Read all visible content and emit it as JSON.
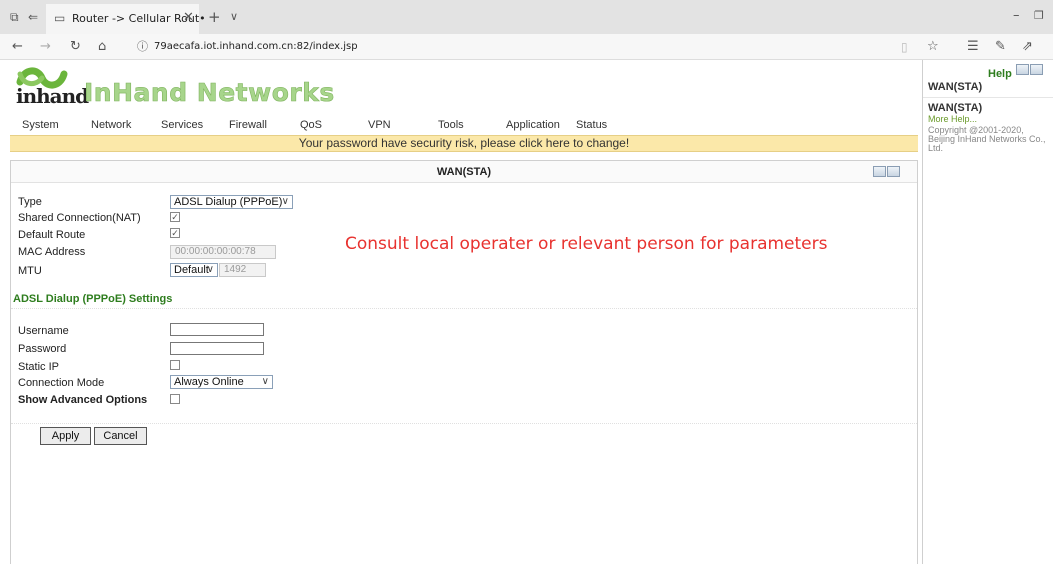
{
  "browser": {
    "tab_title": "Router -> Cellular Rout•",
    "url": "79aecafa.iot.inhand.com.cn:82/index.jsp"
  },
  "header": {
    "logo_word": "inhand",
    "brand": "InHand Networks"
  },
  "menu": [
    "System",
    "Network",
    "Services",
    "Firewall",
    "QoS",
    "VPN",
    "Tools",
    "Application",
    "Status"
  ],
  "warning": "Your password have security risk, please click here to change!",
  "panel": {
    "title": "WAN(STA)",
    "fields": {
      "type_label": "Type",
      "type_value": "ADSL Dialup (PPPoE)",
      "nat_label": "Shared Connection(NAT)",
      "nat_checked": true,
      "route_label": "Default Route",
      "route_checked": true,
      "mac_label": "MAC Address",
      "mac_value": "00:00:00:00:00:78",
      "mtu_label": "MTU",
      "mtu_mode": "Default",
      "mtu_value": "1492"
    },
    "adsl_section": "ADSL Dialup (PPPoE) Settings",
    "adsl": {
      "username_label": "Username",
      "username_value": "",
      "password_label": "Password",
      "password_value": "",
      "static_ip_label": "Static IP",
      "static_ip_checked": false,
      "conn_mode_label": "Connection Mode",
      "conn_mode_value": "Always Online",
      "adv_label": "Show Advanced Options",
      "adv_checked": false
    },
    "apply_label": "Apply",
    "cancel_label": "Cancel"
  },
  "annotation": "Consult local operater or relevant person for parameters",
  "help": {
    "title": "Help",
    "heading": "WAN(STA)",
    "subheading": "WAN(STA)",
    "more": "More Help...",
    "copyright": "Copyright @2001-2020, Beijing InHand Networks Co., Ltd."
  },
  "colors": {
    "brand": "#a7d58b",
    "warning_bg": "#fbe8a9",
    "section": "#2e7d1e",
    "annotation": "#e8322f",
    "link": "#6a9a2a"
  }
}
